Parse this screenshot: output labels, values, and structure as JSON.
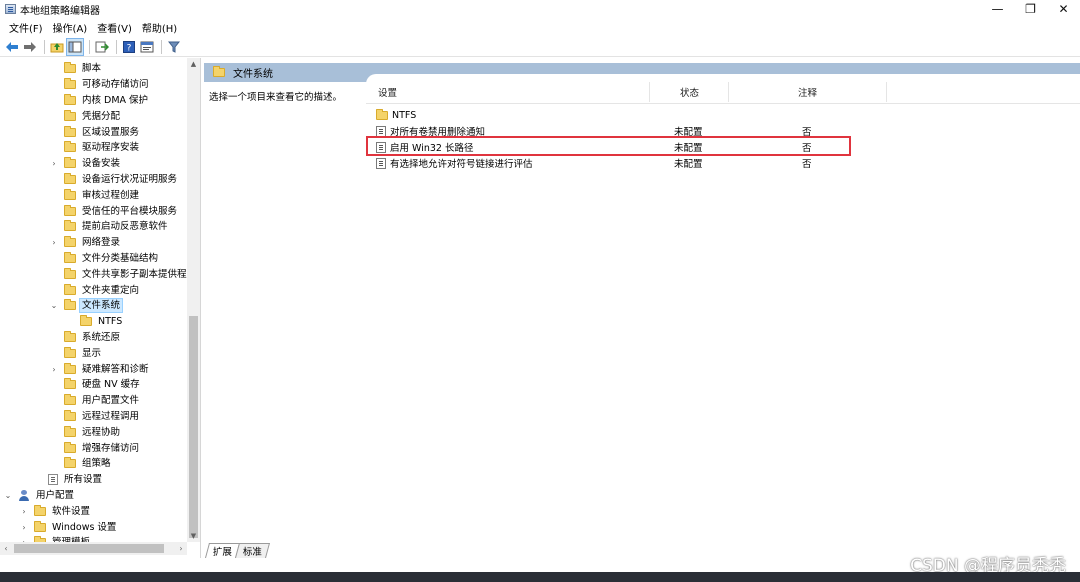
{
  "window": {
    "title": "本地组策略编辑器",
    "controls": {
      "minimize": "—",
      "maximize": "❐",
      "close": "✕"
    }
  },
  "menu": [
    "文件(F)",
    "操作(A)",
    "查看(V)",
    "帮助(H)"
  ],
  "toolbar": {
    "icons": [
      "back-arrow-icon",
      "forward-arrow-icon",
      "up-folder-icon",
      "show-hide-tree-icon",
      "export-list-icon",
      "help-icon",
      "properties-icon",
      "filter-icon"
    ]
  },
  "tree": {
    "items": [
      {
        "label": "脚本",
        "level": 3,
        "icon": "folder",
        "expander": ""
      },
      {
        "label": "可移动存储访问",
        "level": 3,
        "icon": "folder",
        "expander": ""
      },
      {
        "label": "内核 DMA 保护",
        "level": 3,
        "icon": "folder",
        "expander": ""
      },
      {
        "label": "凭据分配",
        "level": 3,
        "icon": "folder",
        "expander": ""
      },
      {
        "label": "区域设置服务",
        "level": 3,
        "icon": "folder",
        "expander": ""
      },
      {
        "label": "驱动程序安装",
        "level": 3,
        "icon": "folder",
        "expander": ""
      },
      {
        "label": "设备安装",
        "level": 3,
        "icon": "folder",
        "expander": "›"
      },
      {
        "label": "设备运行状况证明服务",
        "level": 3,
        "icon": "folder",
        "expander": ""
      },
      {
        "label": "审核过程创建",
        "level": 3,
        "icon": "folder",
        "expander": ""
      },
      {
        "label": "受信任的平台模块服务",
        "level": 3,
        "icon": "folder",
        "expander": ""
      },
      {
        "label": "提前启动反恶意软件",
        "level": 3,
        "icon": "folder",
        "expander": ""
      },
      {
        "label": "网络登录",
        "level": 3,
        "icon": "folder",
        "expander": "›"
      },
      {
        "label": "文件分类基础结构",
        "level": 3,
        "icon": "folder",
        "expander": ""
      },
      {
        "label": "文件共享影子副本提供程序",
        "level": 3,
        "icon": "folder",
        "expander": ""
      },
      {
        "label": "文件夹重定向",
        "level": 3,
        "icon": "folder",
        "expander": ""
      },
      {
        "label": "文件系统",
        "level": 3,
        "icon": "folder",
        "expander": "⌄",
        "selected": true
      },
      {
        "label": "NTFS",
        "level": 4,
        "icon": "folder",
        "expander": ""
      },
      {
        "label": "系统还原",
        "level": 3,
        "icon": "folder",
        "expander": ""
      },
      {
        "label": "显示",
        "level": 3,
        "icon": "folder",
        "expander": ""
      },
      {
        "label": "疑难解答和诊断",
        "level": 3,
        "icon": "folder",
        "expander": "›"
      },
      {
        "label": "硬盘 NV 缓存",
        "level": 3,
        "icon": "folder",
        "expander": ""
      },
      {
        "label": "用户配置文件",
        "level": 3,
        "icon": "folder",
        "expander": ""
      },
      {
        "label": "远程过程调用",
        "level": 3,
        "icon": "folder",
        "expander": ""
      },
      {
        "label": "远程协助",
        "level": 3,
        "icon": "folder",
        "expander": ""
      },
      {
        "label": "增强存储访问",
        "level": 3,
        "icon": "folder",
        "expander": ""
      },
      {
        "label": "组策略",
        "level": 3,
        "icon": "folder",
        "expander": ""
      },
      {
        "label": "所有设置",
        "level": 2,
        "icon": "doc",
        "expander": ""
      },
      {
        "label": "用户配置",
        "level": 0,
        "icon": "user",
        "expander": "⌄"
      },
      {
        "label": "软件设置",
        "level": 1,
        "icon": "folder",
        "expander": "›"
      },
      {
        "label": "Windows 设置",
        "level": 1,
        "icon": "folder",
        "expander": "›"
      },
      {
        "label": "管理模板",
        "level": 1,
        "icon": "folder",
        "expander": "›"
      }
    ]
  },
  "right": {
    "header": "文件系统",
    "description": "选择一个项目来查看它的描述。",
    "columns": {
      "setting": "设置",
      "state": "状态",
      "comment": "注释"
    },
    "rows": [
      {
        "icon": "folder",
        "setting": "NTFS",
        "state": "",
        "comment": ""
      },
      {
        "icon": "setting",
        "setting": "对所有卷禁用删除通知",
        "state": "未配置",
        "comment": "否"
      },
      {
        "icon": "setting",
        "setting": "启用 Win32 长路径",
        "state": "未配置",
        "comment": "否",
        "highlighted": true
      },
      {
        "icon": "setting",
        "setting": "有选择地允许对符号链接进行评估",
        "state": "未配置",
        "comment": "否"
      }
    ]
  },
  "tabs": [
    "扩展",
    "标准"
  ],
  "watermark": "CSDN @程序员秃秃",
  "colors": {
    "header_band": "#a8bfd8",
    "highlight_box": "#e0343e",
    "selection": "#cce8ff"
  }
}
